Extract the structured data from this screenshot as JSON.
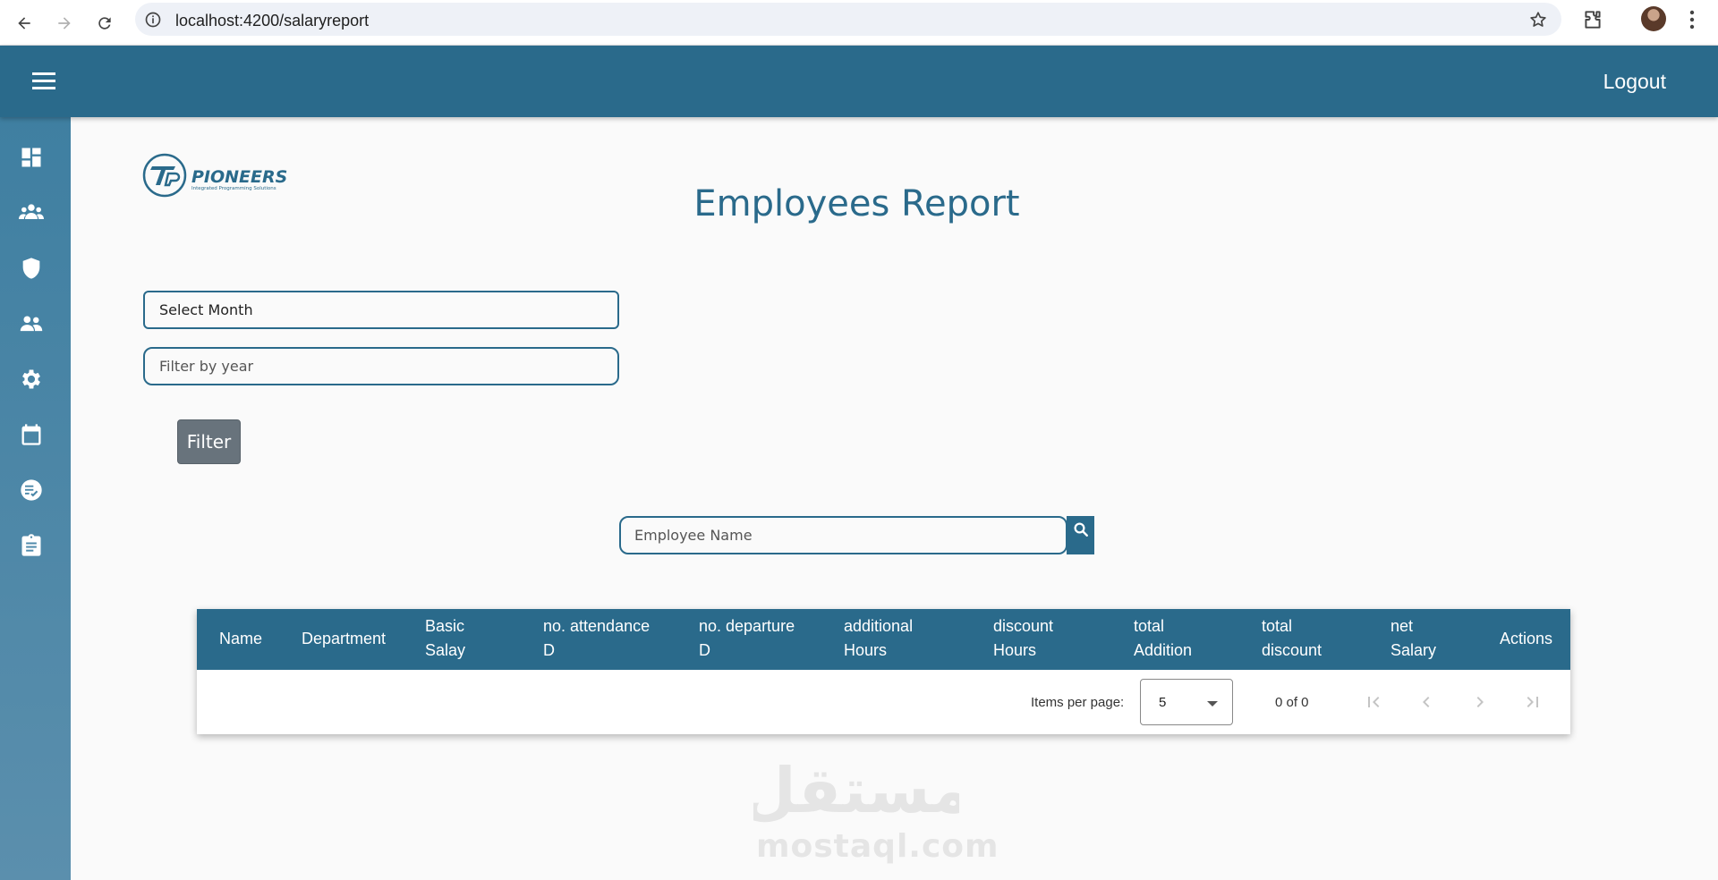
{
  "browser": {
    "url": "localhost:4200/salaryreport"
  },
  "topbar": {
    "logout_label": "Logout"
  },
  "sidebar": {
    "items": [
      {
        "icon": "dashboard-icon"
      },
      {
        "icon": "users-icon"
      },
      {
        "icon": "shield-icon"
      },
      {
        "icon": "groups-icon"
      },
      {
        "icon": "gear-icon"
      },
      {
        "icon": "calendar-icon"
      },
      {
        "icon": "checklist-icon"
      },
      {
        "icon": "clipboard-icon"
      }
    ]
  },
  "logo": {
    "brand": "PIONEERS",
    "tagline": "Integrated Programming Solutions"
  },
  "page": {
    "title": "Employees Report"
  },
  "filters": {
    "month_value": "Select Month",
    "year_placeholder": "Filter by year",
    "filter_label": "Filter"
  },
  "search": {
    "placeholder": "Employee Name"
  },
  "table": {
    "columns": [
      {
        "line1": "Name",
        "line2": ""
      },
      {
        "line1": "Department",
        "line2": ""
      },
      {
        "line1": "Basic",
        "line2": "Salay"
      },
      {
        "line1": "no. attendance",
        "line2": "D"
      },
      {
        "line1": "no. departure",
        "line2": "D"
      },
      {
        "line1": "additional",
        "line2": "Hours"
      },
      {
        "line1": "discount",
        "line2": "Hours"
      },
      {
        "line1": "total",
        "line2": "Addition"
      },
      {
        "line1": "total",
        "line2": "discount"
      },
      {
        "line1": "net",
        "line2": "Salary"
      },
      {
        "line1": "Actions",
        "line2": ""
      }
    ],
    "rows": []
  },
  "paginator": {
    "items_per_page_label": "Items per page:",
    "page_size": "5",
    "range_label": "0 of 0"
  },
  "watermark": {
    "arabic": "مستقل",
    "latin": "mostaql.com"
  },
  "colors": {
    "primary": "#2a6a8b",
    "sidebar": "#4a87a8",
    "filter_button": "#68737c",
    "background": "#fafafa"
  }
}
